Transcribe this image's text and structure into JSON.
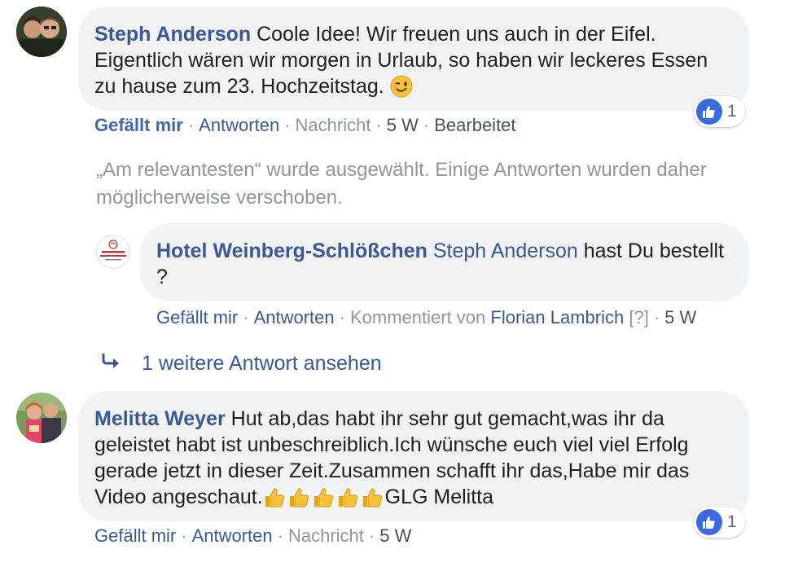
{
  "comments": [
    {
      "author": "Steph Anderson",
      "text": " Coole Idee! Wir freuen uns auch in der Eifel. Eigentlich wären wir morgen in Urlaub, so haben wir leckeres Essen zu hause zum 23. Hochzeitstag. ",
      "emoji": "winking-face",
      "actions": {
        "like": "Gefällt mir",
        "reply": "Antworten",
        "message": "Nachricht",
        "time": "5 W",
        "edited": "Bearbeitet"
      },
      "like_liked": true,
      "reaction_count": "1"
    },
    {
      "author": "Melitta Weyer",
      "text": " Hut ab,das habt ihr sehr gut gemacht,was ihr da geleistet habt ist unbeschreiblich.Ich wünsche euch viel viel Erfolg gerade jetzt in dieser Zeit.Zusammen schafft ihr das,Habe mir das Video angeschaut.",
      "emoji_count": 5,
      "text_suffix": "GLG Melitta",
      "actions": {
        "like": "Gefällt mir",
        "reply": "Antworten",
        "message": "Nachricht",
        "time": "5 W"
      },
      "reaction_count": "1"
    }
  ],
  "notice": "„Am relevantesten“ wurde ausgewählt. Einige Antworten wurden daher möglicherweise verschoben.",
  "reply": {
    "author": "Hotel Weinberg-Schlößchen",
    "tagged": "Steph Anderson",
    "text": " hast Du bestellt ?",
    "avatar_logo_line1": "WEINBERG",
    "avatar_logo_line2": "SCHLÖSSCHEN",
    "actions": {
      "like": "Gefällt mir",
      "reply": "Antworten",
      "commented_by_prefix": "Kommentiert von",
      "commented_by": "Florian Lambrich",
      "help": "[?]",
      "time": "5 W"
    }
  },
  "more_replies": "1 weitere Antwort ansehen",
  "colors": {
    "link": "#385898",
    "bubble": "#f2f3f5",
    "meta": "#90949c",
    "like_blue": "#3b6ae0"
  }
}
